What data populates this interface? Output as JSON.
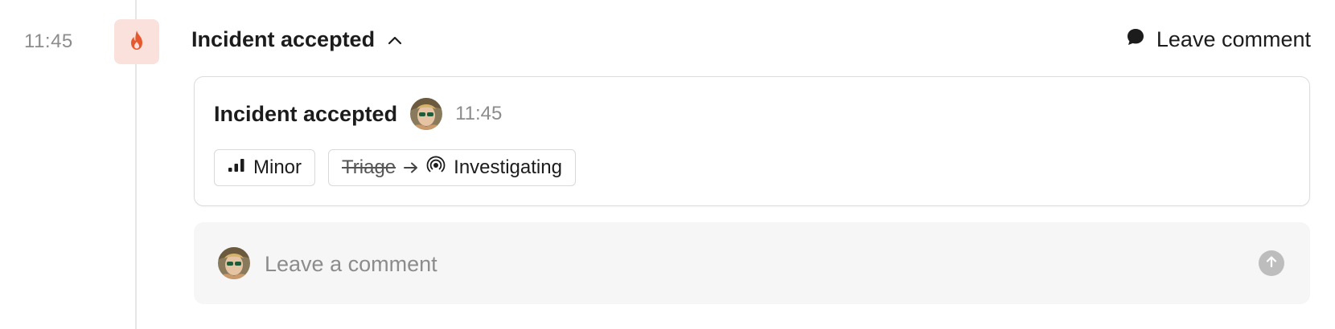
{
  "event": {
    "time": "11:45",
    "icon": "flame-icon",
    "icon_color": "#e8582f",
    "icon_bg": "#fbe1dc",
    "title": "Incident accepted",
    "leave_comment_label": "Leave comment"
  },
  "card": {
    "title": "Incident accepted",
    "time": "11:45",
    "severity_label": "Minor",
    "status_from": "Triage",
    "status_to": "Investigating"
  },
  "comment": {
    "placeholder": "Leave a comment",
    "value": ""
  }
}
